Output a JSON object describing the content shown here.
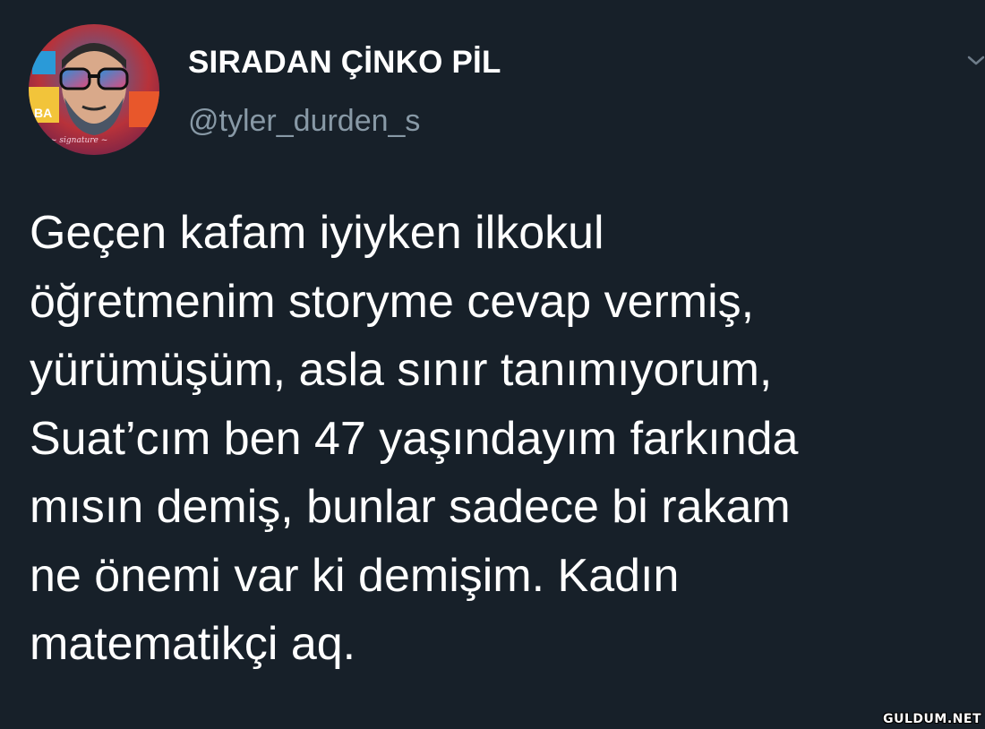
{
  "user": {
    "display_name": "SIRADAN ÇİNKO PİL",
    "handle": "@tyler_durden_s",
    "avatar": "profile-avatar-illustration"
  },
  "tweet": {
    "lines": [
      "Geçen kafam iyiyken ilkokul",
      "öğretmenim storyme cevap vermiş,",
      "yürümüşüm, asla sınır tanımıyorum,",
      "Suat’cım ben 47 yaşındayım farkında",
      "mısın demiş, bunlar sadece bi rakam",
      "ne önemi var ki demişim. Kadın",
      "matematikçi aq."
    ]
  },
  "icons": {
    "menu": "chevron-down-icon"
  },
  "watermark": "GULDUM.NET",
  "colors": {
    "background": "#172029",
    "text": "#ffffff",
    "secondary_text": "#8899a6"
  }
}
